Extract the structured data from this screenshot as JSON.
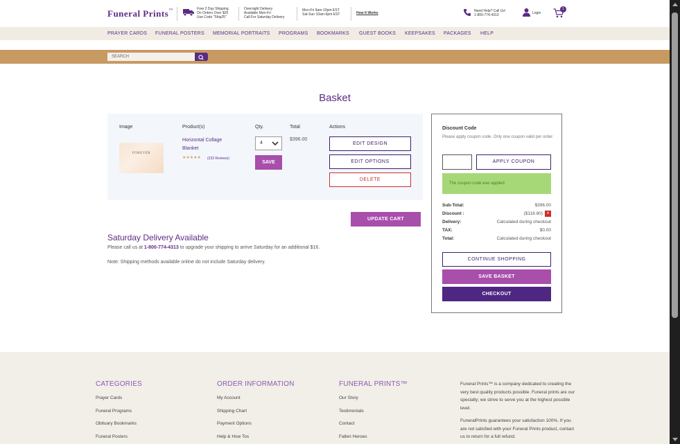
{
  "header": {
    "logo": "Funeral Prints",
    "logo_tm": "™",
    "shipping_line1": "Free 2 Day Shipping",
    "shipping_line2": "On Orders Over $25",
    "shipping_line3": "Use Code \"Ship25\"",
    "overnight_line1": "Overnight Delivery",
    "overnight_line2": "Available Mon-Fri",
    "overnight_line3": "Call For Saturday Delivery",
    "hours_line1": "Mon-Fri 9am-10pm EST",
    "hours_line2": "Sat-Sun 10am-6pm EST",
    "how_it_works": "How It Works",
    "help_line1": "Need Help? Call Us!",
    "help_line2": "1-800-774-4313",
    "login": "Login",
    "cart_count": "1"
  },
  "nav": {
    "items": [
      "PRAYER CARDS",
      "FUNERAL POSTERS",
      "MEMORIAL PORTRAITS",
      "PROGRAMS",
      "BOOKMARKS",
      "GUEST BOOKS",
      "KEEPSAKES",
      "PACKAGES",
      "HELP"
    ]
  },
  "search": {
    "placeholder": "SEARCH"
  },
  "page_title": "Basket",
  "basket": {
    "columns": {
      "image": "Image",
      "product": "Product(s)",
      "qty": "Qty.",
      "total": "Total",
      "actions": "Actions"
    },
    "item": {
      "thumb_text": "FOREVER",
      "name": "Horizontal Collage Blanket",
      "stars": "★★★★★",
      "reviews": "(232 Reviews)",
      "qty": "4",
      "total": "$396.00"
    },
    "save_label": "SAVE",
    "edit_design": "EDIT DESIGN",
    "edit_options": "EDIT OPTIONS",
    "delete": "DELETE",
    "update_cart": "UPDATE CART"
  },
  "saturday": {
    "title": "Saturday Delivery Available",
    "line_pre": "Please call us at ",
    "phone": "1-800-774-4313",
    "line_post": " to upgrade your shipping to arrive Saturday for an additional $16.",
    "note": "Note: Shipping methods available online do not include Saturday delivery."
  },
  "summary": {
    "discount_title": "Discount Code",
    "discount_help": "Please apply coupon code. Only one coupon valid per order.",
    "coupon_value": "",
    "apply_label": "APPLY COUPON",
    "alert": "The coupon code was applied",
    "subtotal_label": "Sub-Total:",
    "subtotal_value": "$396.00",
    "discount_label": "Discount :",
    "discount_value": "($118.80)",
    "remove_x": "x",
    "delivery_label": "Delivery:",
    "delivery_value": "Calculated during checkout",
    "tax_label": "TAX:",
    "tax_value": "$0.00",
    "total_label": "Total:",
    "total_value": "Calculated during checkout",
    "continue_label": "CONTINUE SHOPPING",
    "save_basket_label": "SAVE BASKET",
    "checkout_label": "CHECKOUT"
  },
  "footer": {
    "categories": {
      "title": "CATEGORIES",
      "links": [
        "Prayer Cards",
        "Funeral Programs",
        "Obituary Bookmarks",
        "Funeral Posters"
      ]
    },
    "order_info": {
      "title": "ORDER INFORMATION",
      "links": [
        "My Account",
        "Shipping Chart",
        "Payment Options",
        "Help & How Tos"
      ]
    },
    "funeral_prints": {
      "title": "FUNERAL PRINTS™",
      "links": [
        "Our Story",
        "Testimonials",
        "Contact",
        "Fallen Heroes"
      ]
    },
    "about_p1": "Funeral Prints™ is a company dedicated to creating the very best quality products possible. Funeral prints are our specialty; we strive to serve you at the highest possible level.",
    "about_p2": "FuneralPrints guarantees your satisfaction 100%. If you are not satisfied with your Funeral Prints product, contact us to return for a full refund."
  },
  "colors": {
    "brand_purple": "#5b2c83",
    "accent_magenta": "#a84eab",
    "band_tan": "#c79a62",
    "success_green": "#a7d878"
  }
}
